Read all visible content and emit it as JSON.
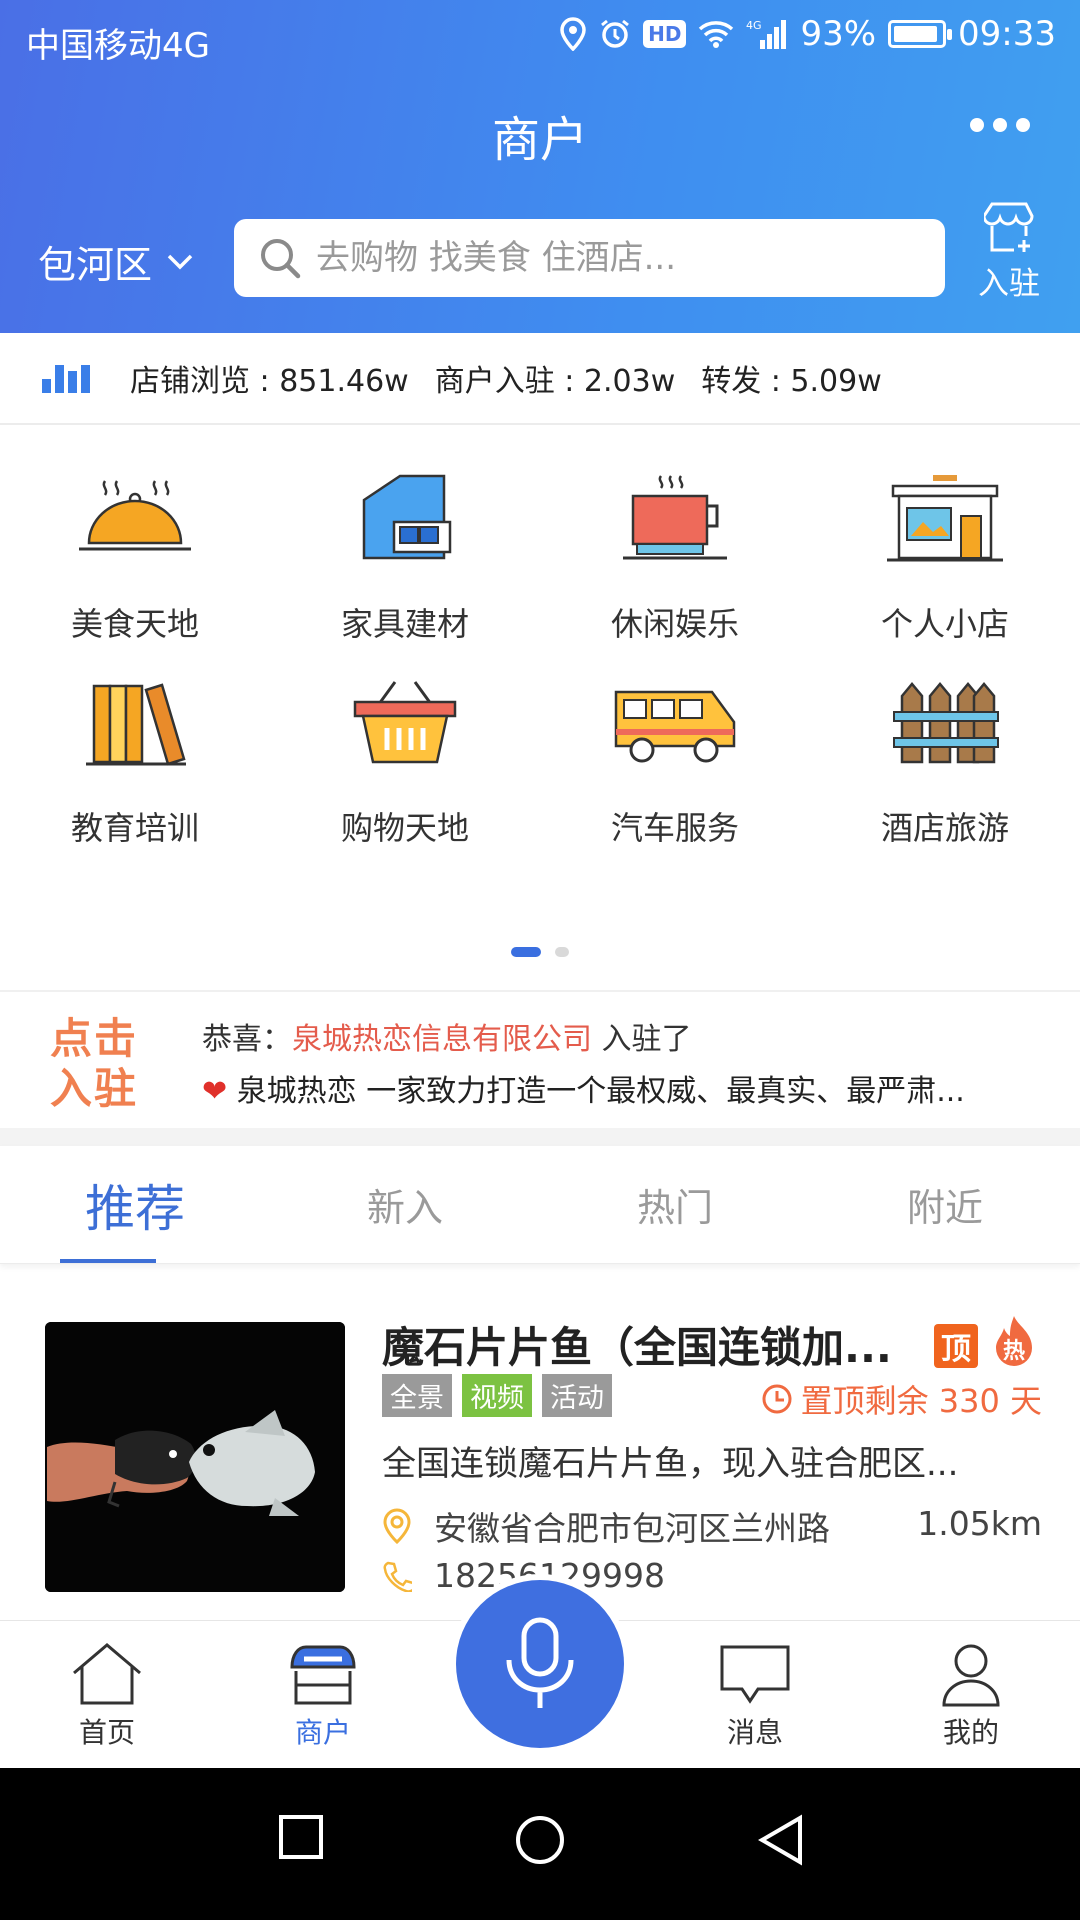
{
  "status_bar": {
    "carrier": "中国移动4G",
    "hd": "HD",
    "network": "4G",
    "battery": "93%",
    "battery_level": 0.93,
    "time": "09:33"
  },
  "header": {
    "title": "商户",
    "district": "包河区",
    "search_placeholder": "去购物 找美食 住酒店...",
    "join_label": "入驻"
  },
  "stats": [
    {
      "label": "店铺浏览",
      "value": "851.46w"
    },
    {
      "label": "商户入驻",
      "value": "2.03w"
    },
    {
      "label": "转发",
      "value": "5.09w"
    }
  ],
  "categories": [
    {
      "label": "美食天地",
      "icon": "food-cloche-icon"
    },
    {
      "label": "家具建材",
      "icon": "furniture-house-icon"
    },
    {
      "label": "休闲娱乐",
      "icon": "coffee-cup-icon"
    },
    {
      "label": "个人小店",
      "icon": "shop-front-icon"
    },
    {
      "label": "教育培训",
      "icon": "books-icon"
    },
    {
      "label": "购物天地",
      "icon": "basket-icon"
    },
    {
      "label": "汽车服务",
      "icon": "van-icon"
    },
    {
      "label": "酒店旅游",
      "icon": "fence-icon"
    }
  ],
  "pager": {
    "pages": 2,
    "current": 1
  },
  "notice": {
    "logo_line1": "点击",
    "logo_line2": "入驻",
    "congrats": "恭喜：",
    "company": "泉城热恋信息有限公司",
    "joined": "入驻了",
    "heart": "❤",
    "message": "泉城热恋 一家致力打造一个最权威、最真实、最严肃..."
  },
  "tabs": [
    {
      "label": "推荐",
      "active": true
    },
    {
      "label": "新入",
      "active": false
    },
    {
      "label": "热门",
      "active": false
    },
    {
      "label": "附近",
      "active": false
    }
  ],
  "store": {
    "name": "魔石片片鱼（全国连锁加...",
    "badge_top": "顶",
    "badge_hot": "热",
    "tags": [
      {
        "label": "全景",
        "color": "#9a9a9a"
      },
      {
        "label": "视频",
        "color": "#7cc242"
      },
      {
        "label": "活动",
        "color": "#9a9a9a"
      }
    ],
    "top_remaining": "置顶剩余 330 天",
    "description": "全国连锁魔石片片鱼，现入驻合肥区...",
    "address": "安徽省合肥市包河区兰州路",
    "distance": "1.05km",
    "phone": "18256129998"
  },
  "bottom_nav": [
    {
      "label": "首页",
      "icon": "home-icon",
      "active": false
    },
    {
      "label": "商户",
      "icon": "store-icon",
      "active": true
    },
    {
      "label": "消息",
      "icon": "message-icon",
      "active": false
    },
    {
      "label": "我的",
      "icon": "user-icon",
      "active": false
    }
  ],
  "colors": {
    "brand": "#3f6fe0",
    "accent": "#f06a40",
    "company": "#e45c4c"
  }
}
